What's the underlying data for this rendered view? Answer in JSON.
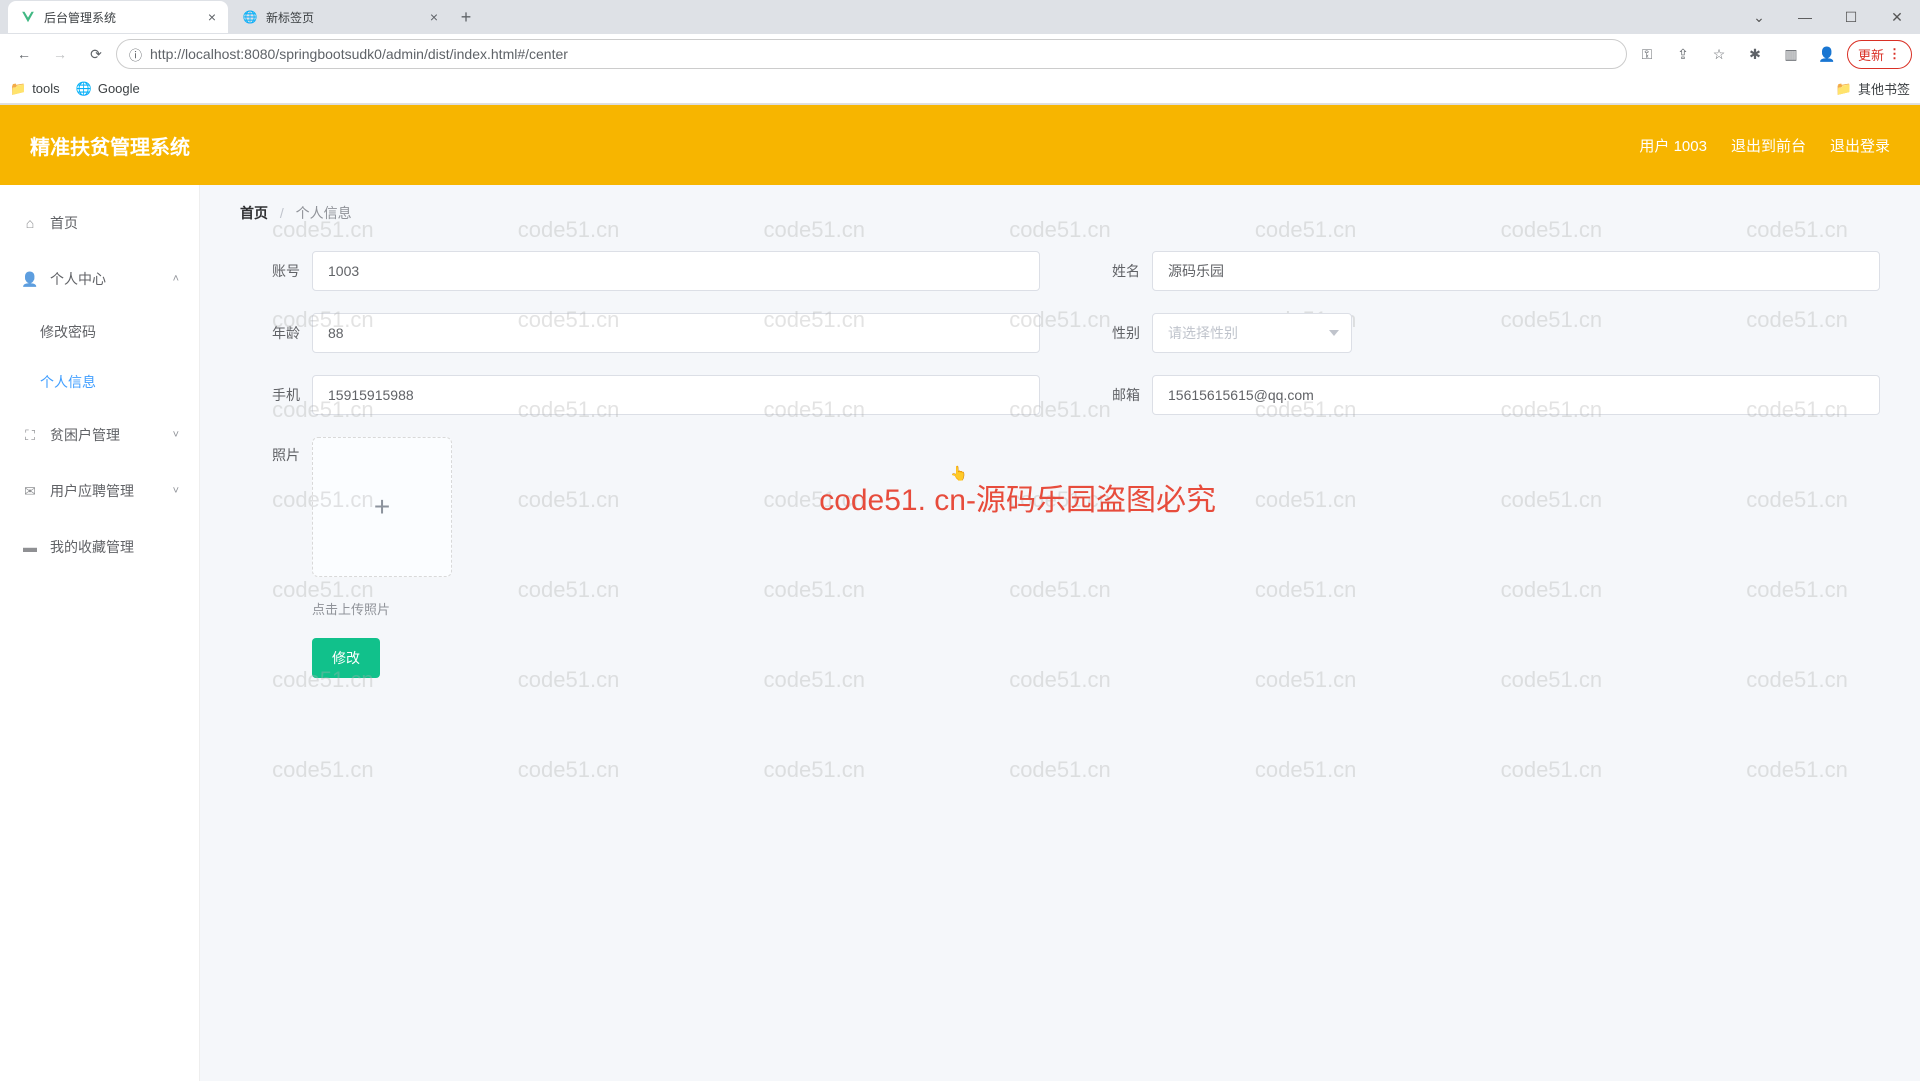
{
  "browser": {
    "tabs": [
      {
        "title": "后台管理系统",
        "active": true
      },
      {
        "title": "新标签页",
        "active": false
      }
    ],
    "url": "http://localhost:8080/springbootsudk0/admin/dist/index.html#/center",
    "update_label": "更新",
    "bookmarks": {
      "tools": "tools",
      "google": "Google",
      "other": "其他书签"
    }
  },
  "header": {
    "app_title": "精准扶贫管理系统",
    "user_label": "用户 1003",
    "exit_front": "退出到前台",
    "logout": "退出登录"
  },
  "sidebar": {
    "home": "首页",
    "personal": "个人中心",
    "change_pwd": "修改密码",
    "profile": "个人信息",
    "poor_mgmt": "贫困户管理",
    "apply_mgmt": "用户应聘管理",
    "fav_mgmt": "我的收藏管理"
  },
  "breadcrumb": {
    "home": "首页",
    "current": "个人信息"
  },
  "form": {
    "account_label": "账号",
    "account_value": "1003",
    "name_label": "姓名",
    "name_value": "源码乐园",
    "age_label": "年龄",
    "age_value": "88",
    "gender_label": "性别",
    "gender_placeholder": "请选择性别",
    "phone_label": "手机",
    "phone_value": "15915915988",
    "email_label": "邮箱",
    "email_value": "15615615615@qq.com",
    "photo_label": "照片",
    "upload_tip": "点击上传照片",
    "submit_label": "修改"
  },
  "watermark": {
    "text": "code51.cn",
    "center": "code51. cn-源码乐园盗图必究"
  }
}
